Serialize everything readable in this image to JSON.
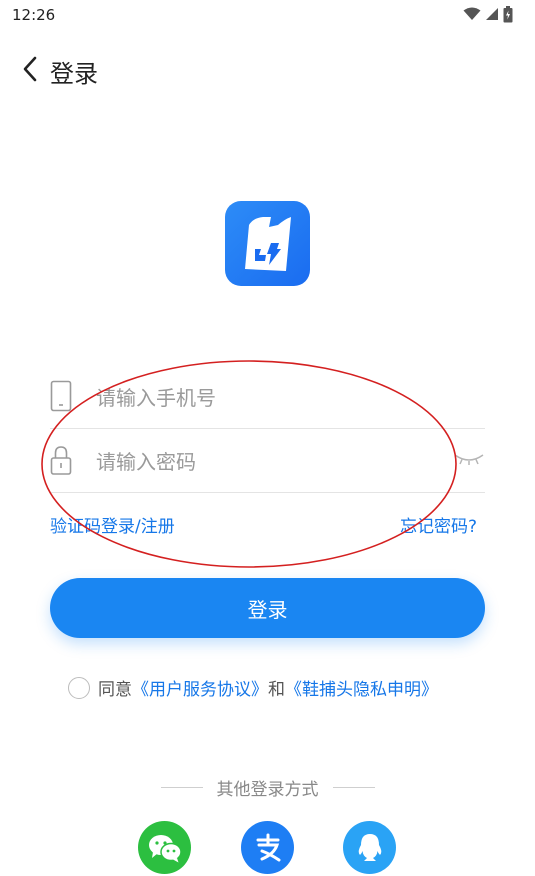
{
  "status_bar": {
    "time": "12:26",
    "icons": [
      "wifi-icon",
      "signal-icon",
      "battery-icon"
    ]
  },
  "nav": {
    "back_icon": "chevron-left-icon",
    "title": "登录"
  },
  "logo": {
    "icon": "app-logo-icon",
    "color": "#1a6cf0"
  },
  "form": {
    "phone": {
      "placeholder": "请输入手机号",
      "value": "",
      "icon": "phone-icon"
    },
    "password": {
      "placeholder": "请输入密码",
      "value": "",
      "icon": "lock-icon",
      "toggle_icon": "eye-closed-icon"
    }
  },
  "links": {
    "code_login": "验证码登录/注册",
    "forgot": "忘记密码?"
  },
  "login_button": {
    "label": "登录",
    "color": "#1a86f2"
  },
  "agreement": {
    "checked": false,
    "prefix": "同意",
    "user_agreement": "《用户服务协议》",
    "and": "和",
    "privacy": "《鞋捕头隐私申明》"
  },
  "other_login": {
    "title": "其他登录方式",
    "methods": [
      {
        "name": "wechat",
        "icon": "wechat-icon",
        "color": "#2cbf40"
      },
      {
        "name": "alipay",
        "icon": "alipay-icon",
        "color": "#1e7ef4"
      },
      {
        "name": "qq",
        "icon": "qq-icon",
        "color": "#2aa3f5"
      }
    ]
  },
  "annotation": {
    "shape": "ellipse",
    "color": "#d42020"
  }
}
